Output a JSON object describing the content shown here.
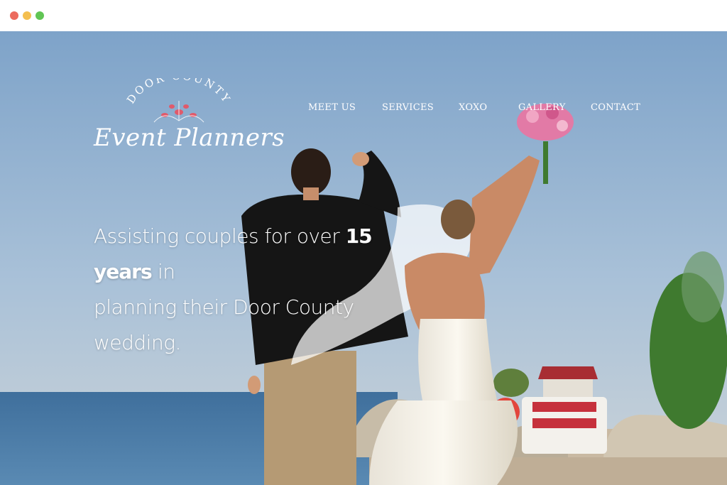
{
  "window": {
    "controls": [
      "close",
      "minimize",
      "maximize"
    ],
    "colors": {
      "close": "#ec6b5e",
      "minimize": "#f4bf4f",
      "maximize": "#61c554"
    }
  },
  "logo": {
    "arc_text": "DOOR COUNTY",
    "script_text": "Event Planners",
    "accent_color": "#e05a6b"
  },
  "nav": {
    "items": [
      {
        "label": "MEET US"
      },
      {
        "label": "SERVICES"
      },
      {
        "label": "XOXO"
      },
      {
        "label": "GALLERY"
      },
      {
        "label": "CONTACT"
      }
    ]
  },
  "hero": {
    "tagline_start": "Assisting couples for over ",
    "tagline_highlight": "15 years",
    "tagline_mid": " in",
    "tagline_line2": "planning their Door County wedding."
  }
}
